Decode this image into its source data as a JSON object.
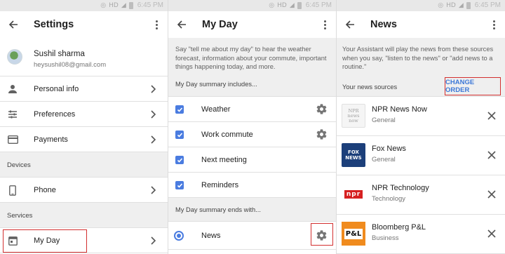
{
  "status": {
    "time": "6:45 PM",
    "network": "HD"
  },
  "settings": {
    "title": "Settings",
    "profile": {
      "name": "Sushil sharma",
      "email": "heysushil08@gmail.com"
    },
    "items": [
      {
        "label": "Personal info",
        "icon": "person-icon"
      },
      {
        "label": "Preferences",
        "icon": "sliders-icon"
      },
      {
        "label": "Payments",
        "icon": "credit-card-icon"
      }
    ],
    "devices_header": "Devices",
    "devices": [
      {
        "label": "Phone",
        "icon": "phone-icon"
      }
    ],
    "services_header": "Services",
    "services": [
      {
        "label": "My Day",
        "icon": "calendar-icon"
      }
    ]
  },
  "myday": {
    "title": "My Day",
    "intro": "Say \"tell me about my day\" to hear the weather forecast, information about your commute, important things happening today, and more.",
    "includes_header": "My Day summary includes...",
    "includes": [
      {
        "label": "Weather",
        "checked": true,
        "has_settings": true
      },
      {
        "label": "Work commute",
        "checked": true,
        "has_settings": true
      },
      {
        "label": "Next meeting",
        "checked": true,
        "has_settings": false
      },
      {
        "label": "Reminders",
        "checked": true,
        "has_settings": false
      }
    ],
    "ends_header": "My Day summary ends with...",
    "ends": [
      {
        "label": "News",
        "selected": true,
        "has_settings": true
      }
    ]
  },
  "news": {
    "title": "News",
    "intro": "Your Assistant will play the news from these sources when you say, \"listen to the news\" or \"add news to a routine.\"",
    "sources_label": "Your news sources",
    "change_order": "CHANGE ORDER",
    "sources": [
      {
        "name": "NPR News Now",
        "category": "General",
        "logo": "npr-news-now-logo",
        "logo_text": "NPR news now"
      },
      {
        "name": "Fox News",
        "category": "General",
        "logo": "fox-news-logo",
        "logo_text": "FOX NEWS"
      },
      {
        "name": "NPR Technology",
        "category": "Technology",
        "logo": "npr-logo",
        "logo_text": "npr"
      },
      {
        "name": "Bloomberg P&L",
        "category": "Business",
        "logo": "bloomberg-pl-logo",
        "logo_text": "P&L"
      }
    ]
  },
  "colors": {
    "accent": "#4a7ce0",
    "highlight": "#d32f2f",
    "link": "#3c78d8"
  }
}
